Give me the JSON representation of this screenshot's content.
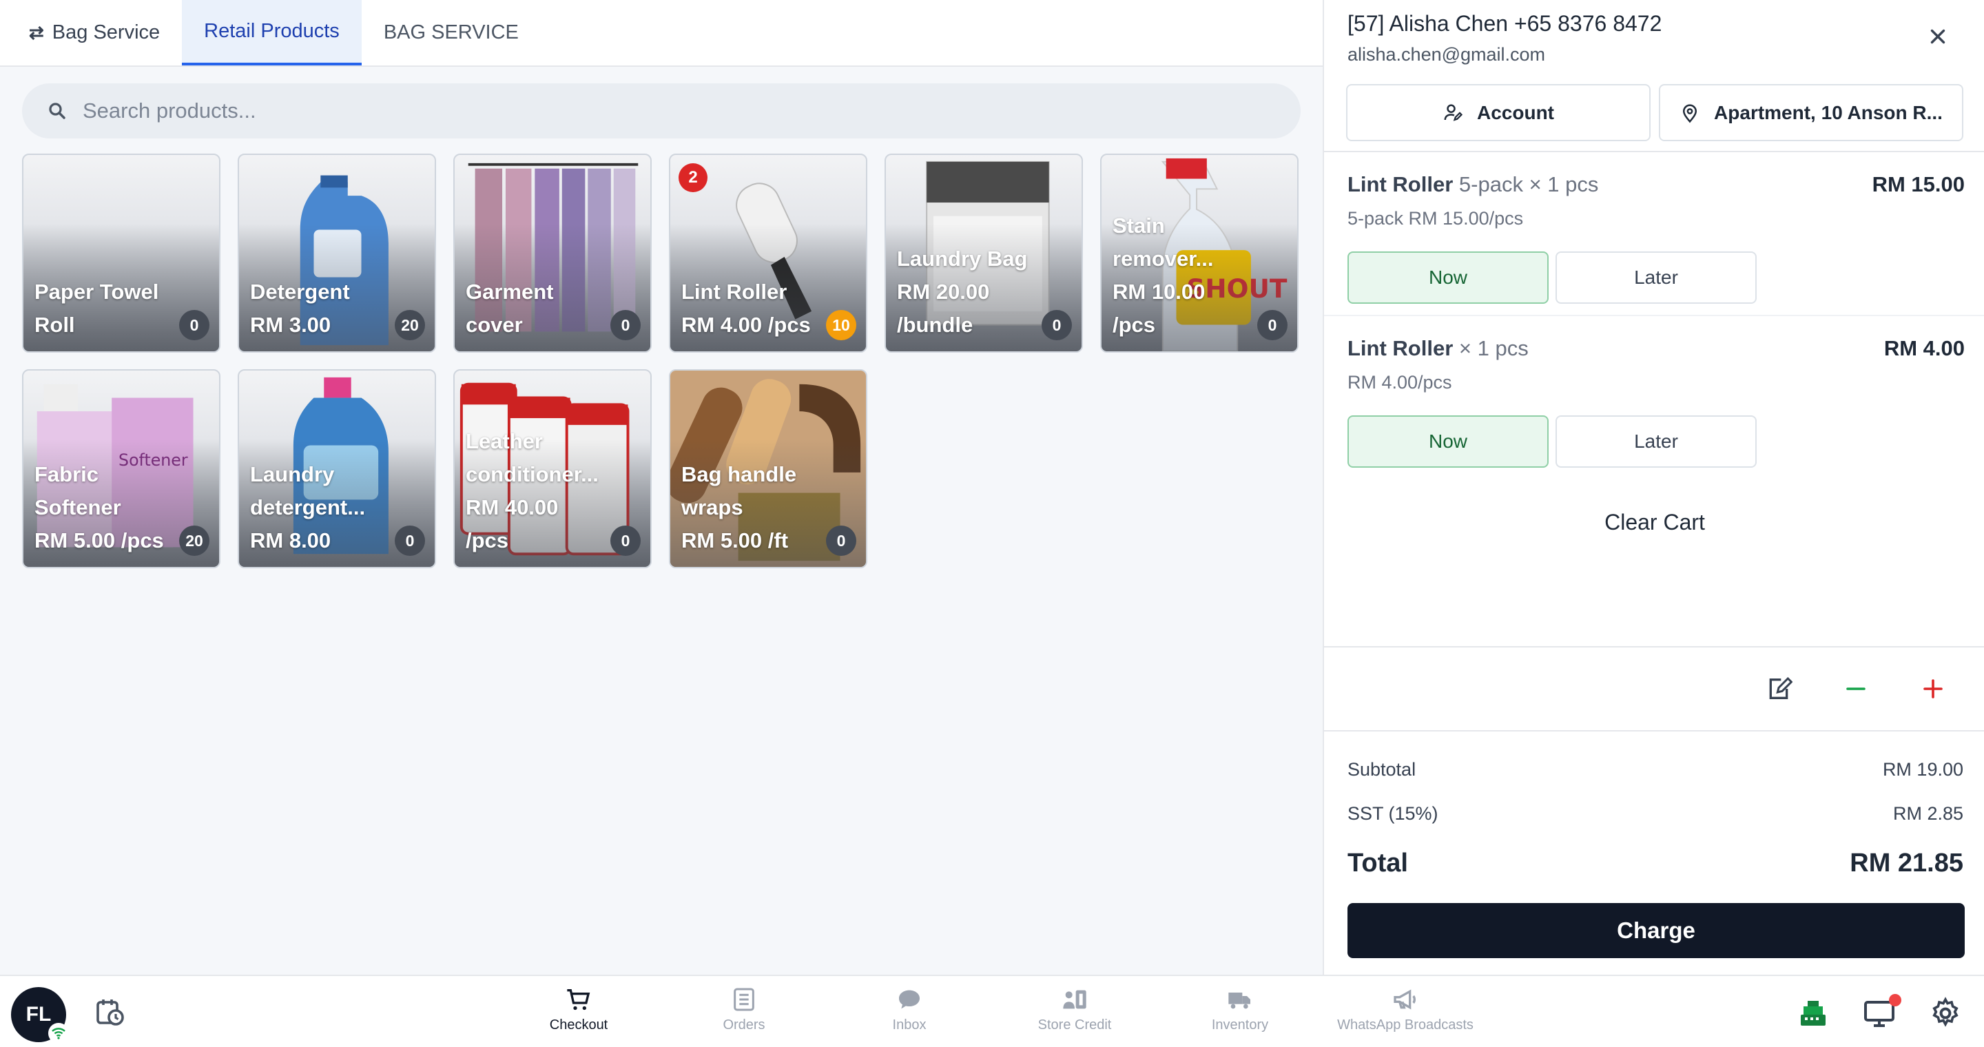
{
  "tabs": [
    {
      "label": "Bag Service",
      "icon": "swap-icon"
    },
    {
      "label": "Retail Products"
    },
    {
      "label": "BAG SERVICE"
    }
  ],
  "search": {
    "placeholder": "Search products..."
  },
  "products": [
    {
      "name": "Paper Towel Roll",
      "line1": "Paper Towel",
      "line2": "Roll",
      "line3": "",
      "count": "0"
    },
    {
      "name": "Detergent",
      "line1": "Detergent",
      "line2": "RM 3.00",
      "line3": "",
      "count": "20"
    },
    {
      "name": "Garment cover",
      "line1": "Garment",
      "line2": "cover",
      "line3": "",
      "count": "0"
    },
    {
      "name": "Lint Roller",
      "line1": "Lint Roller",
      "line2": "RM 4.00 /pcs",
      "line3": "",
      "count": "10",
      "cart_badge": "2"
    },
    {
      "name": "Laundry Bag",
      "line1": "Laundry Bag",
      "line2": "RM 20.00",
      "line3": "/bundle",
      "count": "0"
    },
    {
      "name": "Stain remover",
      "line1": "Stain",
      "line2": "remover...",
      "line3": "RM 10.00",
      "line4": "/pcs",
      "count": "0"
    },
    {
      "name": "Fabric Softener",
      "line1": "Fabric",
      "line2": "Softener",
      "line3": "RM 5.00 /pcs",
      "count": "20"
    },
    {
      "name": "Laundry detergent",
      "line1": "Laundry",
      "line2": "detergent...",
      "line3": "RM 8.00",
      "count": "0"
    },
    {
      "name": "Leather conditioner",
      "line1": "Leather",
      "line2": "conditioner...",
      "line3": "RM 40.00",
      "line4": "/pcs",
      "count": "0"
    },
    {
      "name": "Bag handle wraps",
      "line1": "Bag handle",
      "line2": "wraps",
      "line3": "RM 5.00 /ft",
      "count": "0"
    }
  ],
  "customer": {
    "name_line": "[57] Alisha Chen +65 8376 8472",
    "email": "alisha.chen@gmail.com",
    "account_label": "Account",
    "address_label": "Apartment, 10 Anson R..."
  },
  "cart": {
    "items": [
      {
        "name": "Lint Roller",
        "variant": "5-pack × 1 pcs",
        "price": "RM 15.00",
        "sub": "5-pack RM 15.00/pcs",
        "now": "Now",
        "later": "Later"
      },
      {
        "name": "Lint Roller",
        "variant": "× 1 pcs",
        "price": "RM 4.00",
        "sub": "RM 4.00/pcs",
        "now": "Now",
        "later": "Later"
      }
    ],
    "clear_label": "Clear Cart"
  },
  "summary": {
    "subtotal_label": "Subtotal",
    "subtotal": "RM 19.00",
    "tax_label": "SST (15%)",
    "tax": "RM 2.85",
    "total_label": "Total",
    "total": "RM 21.85",
    "charge_label": "Charge"
  },
  "bottom": {
    "avatar": "FL",
    "nav": [
      {
        "label": "Checkout",
        "icon": "cart-icon",
        "active": true
      },
      {
        "label": "Orders",
        "icon": "orders-icon"
      },
      {
        "label": "Inbox",
        "icon": "chat-icon"
      },
      {
        "label": "Store Credit",
        "icon": "wallet-icon"
      },
      {
        "label": "Inventory",
        "icon": "truck-icon"
      },
      {
        "label": "WhatsApp Broadcasts",
        "icon": "megaphone-icon"
      }
    ]
  },
  "colors": {
    "accent": "#2563eb",
    "charge": "#111827",
    "now_green": "#e9f7ee",
    "badge_red": "#dc2626",
    "count_orange": "#f59e0b"
  }
}
